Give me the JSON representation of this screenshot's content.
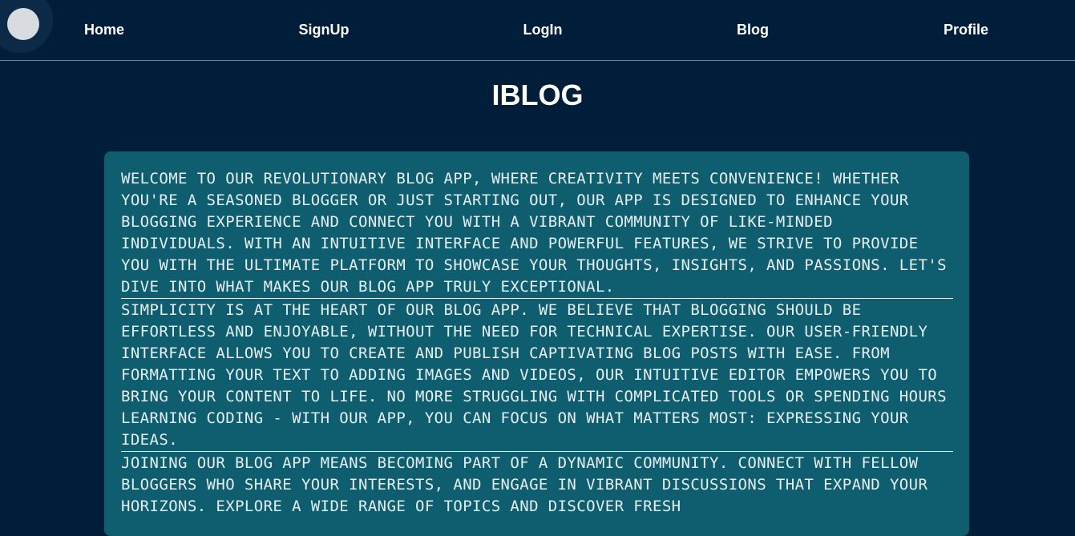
{
  "nav": {
    "items": [
      {
        "label": "Home"
      },
      {
        "label": "SignUp"
      },
      {
        "label": "LogIn"
      },
      {
        "label": "Blog"
      },
      {
        "label": "Profile"
      }
    ]
  },
  "page": {
    "title": "IBLOG"
  },
  "content": {
    "paragraphs": [
      "Welcome to our revolutionary blog app, where creativity meets convenience! Whether you're a seasoned blogger or just starting out, our app is designed to enhance your blogging experience and connect you with a vibrant community of like-minded individuals. With an intuitive interface and powerful features, we strive to provide you with the ultimate platform to showcase your thoughts, insights, and passions. Let's dive into what makes our blog app truly exceptional.",
      "Simplicity is at the heart of our blog app. We believe that blogging should be effortless and enjoyable, without the need for technical expertise. Our user-friendly interface allows you to create and publish captivating blog posts with ease. From formatting your text to adding images and videos, our intuitive editor empowers you to bring your content to life. No more struggling with complicated tools or spending hours learning coding - with our app, you can focus on what matters most: expressing your ideas.",
      "Joining our blog app means becoming part of a dynamic community. Connect with fellow bloggers who share your interests, and engage in vibrant discussions that expand your horizons. Explore a wide range of topics and discover fresh"
    ]
  },
  "colors": {
    "background": "#001d39",
    "card": "#0f5e6f",
    "text": "#e5eef0",
    "logo_circle": "#d8dbe0"
  }
}
